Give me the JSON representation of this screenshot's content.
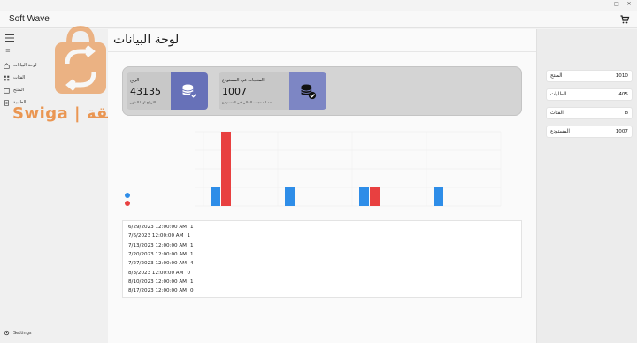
{
  "window": {
    "title": "Soft Wave"
  },
  "page": {
    "title": "لوحة البيانات"
  },
  "sidebar": {
    "items": [
      {
        "label": "لوحة البيانات"
      },
      {
        "label": "الفئات"
      },
      {
        "label": "المنتج"
      },
      {
        "label": "الطلبية"
      }
    ],
    "settings_label": "Settings"
  },
  "watermark": {
    "text": "Swiga | تسويقة"
  },
  "cards": {
    "profit": {
      "label": "الربح",
      "value": "43135",
      "sub": "الارباح لهذا الشهر"
    },
    "stock": {
      "label": "المنتجات في المستودع",
      "value": "1007",
      "sub": "عدد المنتجات الحالي في المستودع"
    }
  },
  "colors": {
    "accent": "#6771b8",
    "series_a": "#2e8de8",
    "series_b": "#e84040"
  },
  "chart_data": {
    "type": "bar",
    "series": [
      {
        "values": [
          1,
          1,
          1,
          1
        ]
      },
      {
        "values": [
          4,
          0,
          1,
          0
        ]
      }
    ],
    "ylim": [
      0,
      4
    ]
  },
  "orders": [
    {
      "date": "6/29/2023 12:00:00 AM",
      "count": "1"
    },
    {
      "date": "7/6/2023 12:00:00 AM",
      "count": "1"
    },
    {
      "date": "7/13/2023 12:00:00 AM",
      "count": "1"
    },
    {
      "date": "7/20/2023 12:00:00 AM",
      "count": "1"
    },
    {
      "date": "7/27/2023 12:00:00 AM",
      "count": "4"
    },
    {
      "date": "8/3/2023 12:00:00 AM",
      "count": "0"
    },
    {
      "date": "8/10/2023 12:00:00 AM",
      "count": "1"
    },
    {
      "date": "8/17/2023 12:00:00 AM",
      "count": "0"
    }
  ],
  "stats": [
    {
      "label": "المنتج",
      "value": "1010"
    },
    {
      "label": "الطلبات",
      "value": "405"
    },
    {
      "label": "الفئات",
      "value": "8"
    },
    {
      "label": "المستودع",
      "value": "1007"
    }
  ]
}
